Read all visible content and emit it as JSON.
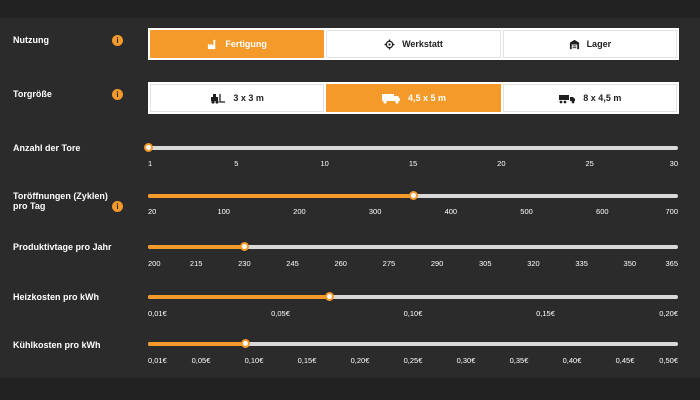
{
  "rows": {
    "nutzung": {
      "label": "Nutzung",
      "options": [
        {
          "label": "Fertigung",
          "icon": "factory-icon",
          "active": true
        },
        {
          "label": "Werkstatt",
          "icon": "wrench-gear-icon",
          "active": false
        },
        {
          "label": "Lager",
          "icon": "warehouse-icon",
          "active": false
        }
      ]
    },
    "torgroesse": {
      "label": "Torgröße",
      "options": [
        {
          "label": "3 x 3 m",
          "icon": "forklift-icon",
          "active": false
        },
        {
          "label": "4,5 x 5 m",
          "icon": "truck-icon",
          "active": true
        },
        {
          "label": "8 x 4,5 m",
          "icon": "trailer-truck-icon",
          "active": false
        }
      ]
    },
    "anzahl": {
      "label": "Anzahl der Tore",
      "min": 1,
      "max": 30,
      "value": 1,
      "ticks": [
        "1",
        "5",
        "10",
        "15",
        "20",
        "25",
        "30"
      ]
    },
    "oeffnungen": {
      "label": "Toröffnungen (Zyklen) pro Tag",
      "min": 20,
      "max": 700,
      "value": 360,
      "ticks": [
        "20",
        "100",
        "200",
        "300",
        "400",
        "500",
        "600",
        "700"
      ]
    },
    "produktivtage": {
      "label": "Produktivtage pro Jahr",
      "min": 200,
      "max": 365,
      "value": 230,
      "ticks": [
        "200",
        "215",
        "230",
        "245",
        "260",
        "275",
        "290",
        "305",
        "320",
        "335",
        "350",
        "365"
      ]
    },
    "heizkosten": {
      "label": "Heizkosten pro kWh",
      "min": 0.01,
      "max": 0.2,
      "value": 0.075,
      "ticks": [
        "0,01€",
        "0,05€",
        "0,10€",
        "0,15€",
        "0,20€"
      ]
    },
    "kuehlkosten": {
      "label": "Kühlkosten pro kWh",
      "min": 0.01,
      "max": 0.5,
      "value": 0.1,
      "ticks": [
        "0,01€",
        "0,05€",
        "0,10€",
        "0,15€",
        "0,20€",
        "0,25€",
        "0,30€",
        "0,35€",
        "0,40€",
        "0,45€",
        "0,50€"
      ]
    }
  },
  "info_glyph": "i",
  "colors": {
    "accent": "#f39a2b",
    "background": "#2b2b2b",
    "track": "#d9d9d9"
  }
}
